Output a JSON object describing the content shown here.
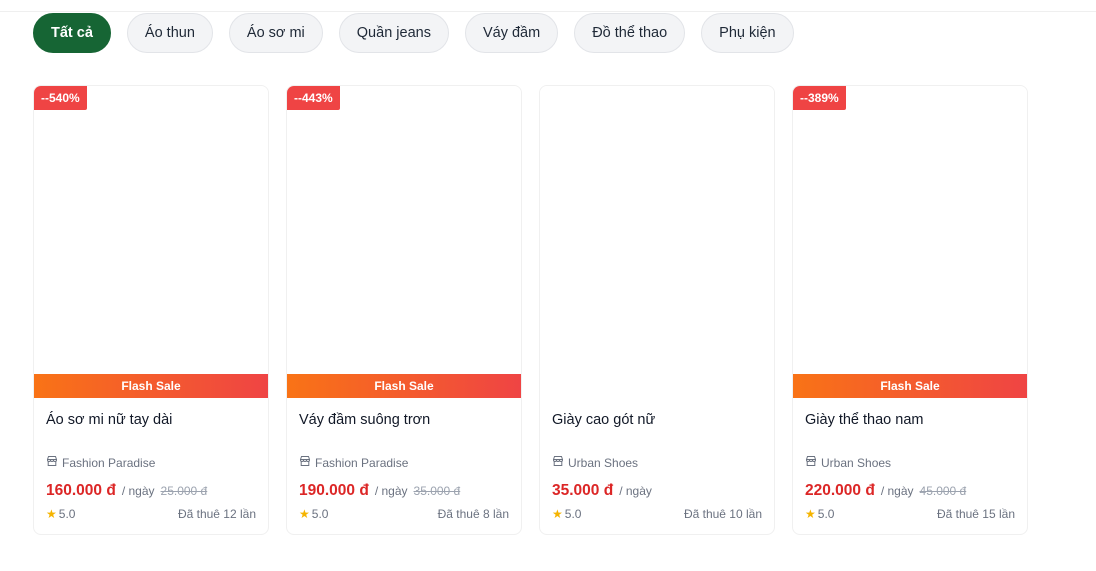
{
  "filters": [
    {
      "label": "Tất cả",
      "active": true
    },
    {
      "label": "Áo thun"
    },
    {
      "label": "Áo sơ mi"
    },
    {
      "label": "Quần jeans"
    },
    {
      "label": "Váy đầm"
    },
    {
      "label": "Đồ thể thao"
    },
    {
      "label": "Phụ kiện"
    }
  ],
  "products": [
    {
      "discount": "--540%",
      "flash_label": "Flash Sale",
      "name": "Áo sơ mi nữ tay dài",
      "shop": "Fashion Paradise",
      "price": "160.000 đ",
      "unit": "/ ngày",
      "old_price": "25.000 đ",
      "rating": "5.0",
      "rented": "Đã thuê 12 lần"
    },
    {
      "discount": "--443%",
      "flash_label": "Flash Sale",
      "name": "Váy đầm suông trơn",
      "shop": "Fashion Paradise",
      "price": "190.000 đ",
      "unit": "/ ngày",
      "old_price": "35.000 đ",
      "rating": "5.0",
      "rented": "Đã thuê 8 lần"
    },
    {
      "name": "Giày cao gót nữ",
      "shop": "Urban Shoes",
      "price": "35.000 đ",
      "unit": "/ ngày",
      "rating": "5.0",
      "rented": "Đã thuê 10 lần"
    },
    {
      "discount": "--389%",
      "flash_label": "Flash Sale",
      "name": "Giày thể thao nam",
      "shop": "Urban Shoes",
      "price": "220.000 đ",
      "unit": "/ ngày",
      "old_price": "45.000 đ",
      "rating": "5.0",
      "rented": "Đã thuê 15 lần"
    }
  ],
  "icons": {
    "shop": "store-icon",
    "rating": "star-icon"
  },
  "colors": {
    "accent": "#166534",
    "price": "#dc2626",
    "discount": "#ef4444",
    "flash_from": "#f97316",
    "flash_to": "#ef4444",
    "star": "#f5b400"
  }
}
